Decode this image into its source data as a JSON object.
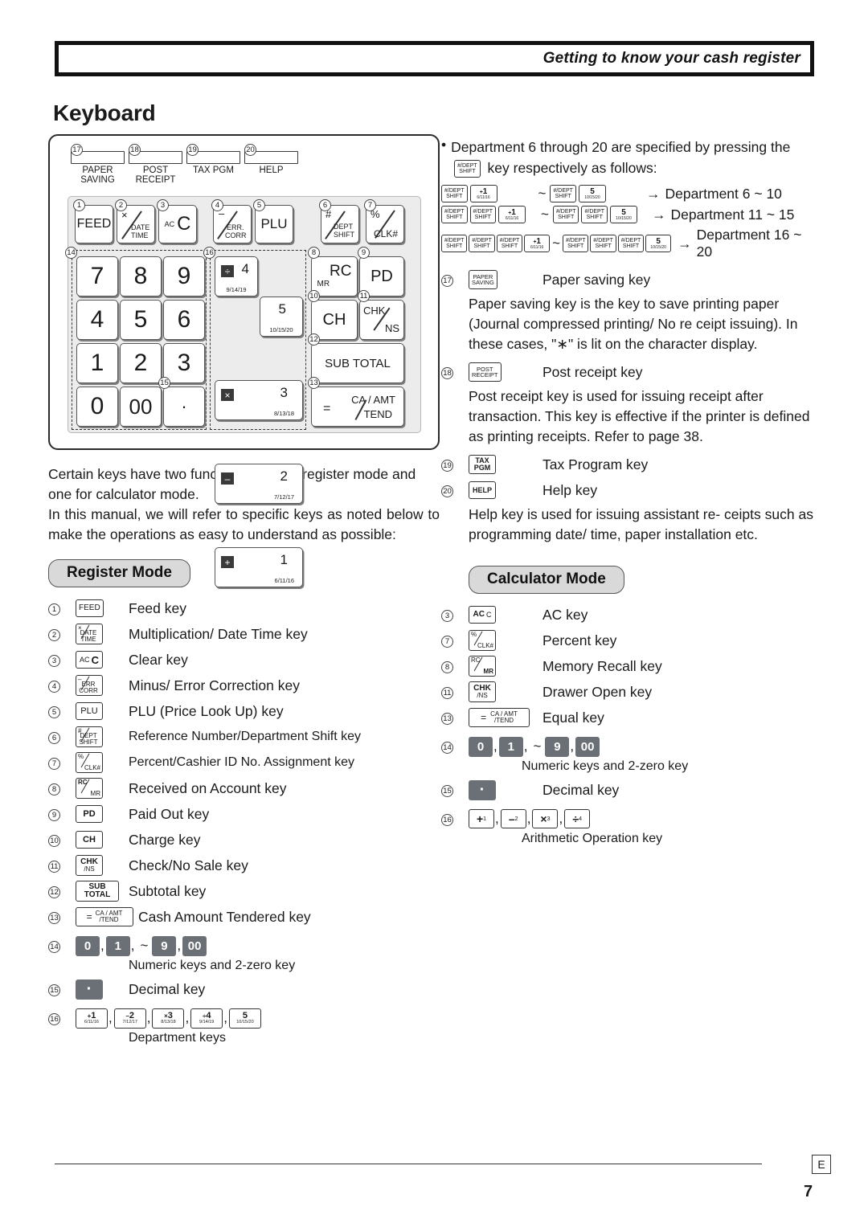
{
  "header": {
    "title": "Getting to know your cash register"
  },
  "page": {
    "title": "Keyboard",
    "number": "7",
    "lang_mark": "E"
  },
  "keyboard_diagram": {
    "top_keys": [
      {
        "num": "17",
        "label_line1": "PAPER",
        "label_line2": "SAVING"
      },
      {
        "num": "18",
        "label_line1": "POST",
        "label_line2": "RECEIPT"
      },
      {
        "num": "19",
        "label_line1": "TAX PGM",
        "label_line2": ""
      },
      {
        "num": "20",
        "label_line1": "HELP",
        "label_line2": ""
      }
    ],
    "function_row": [
      {
        "num": "1",
        "label": "FEED"
      },
      {
        "num": "2",
        "label_top": "×",
        "label_mid": "DATE",
        "label_bot": "TIME"
      },
      {
        "num": "3",
        "label_small": "AC",
        "label_big": "C"
      },
      {
        "num": "4",
        "label_top": "–",
        "label_mid": "ERR.",
        "label_bot": "CORR"
      },
      {
        "num": "5",
        "label": "PLU"
      },
      {
        "num": "6",
        "label_top": "#",
        "label_mid": "DEPT",
        "label_bot": "SHIFT"
      },
      {
        "num": "7",
        "label_top": "%",
        "label_bot": "CLK#"
      }
    ],
    "numeric_group_num": "14",
    "numeric_keys": [
      "7",
      "8",
      "9",
      "4",
      "5",
      "6",
      "1",
      "2",
      "3",
      "0",
      "00"
    ],
    "decimal_group_num": "15",
    "decimal_key": "·",
    "dept_group_num": "16",
    "dept_keys": [
      {
        "op": "÷",
        "num": "4",
        "sub": "9/14/19"
      },
      {
        "op": "",
        "num": "5",
        "sub": "10/15/20"
      },
      {
        "op": "×",
        "num": "3",
        "sub": "8/13/18"
      },
      {
        "op": "–",
        "num": "2",
        "sub": "7/12/17"
      },
      {
        "op": "+",
        "num": "1",
        "sub": "6/11/16"
      }
    ],
    "right_keys": [
      {
        "num": "8",
        "label_small": "MR",
        "label_big": "RC"
      },
      {
        "num": "9",
        "label": "PD"
      },
      {
        "num": "10",
        "label": "CH"
      },
      {
        "num": "11",
        "label_top": "CHK",
        "label_bot": "NS"
      },
      {
        "num": "12",
        "label": "SUB TOTAL"
      },
      {
        "num": "13",
        "label_eq": "=",
        "label_top": "CA / AMT",
        "label_bot": "TEND"
      }
    ]
  },
  "left_column": {
    "intro_p1": "Certain keys have two functions; one for register mode and one for calculator mode.",
    "intro_p2": "In this manual, we will refer to specific keys as noted below to make the operations as easy to understand as possible:",
    "register_mode_badge": "Register Mode",
    "items": [
      {
        "idx": "1",
        "key": {
          "type": "text",
          "text": "FEED"
        },
        "desc": "Feed key"
      },
      {
        "idx": "2",
        "key": {
          "type": "two",
          "l1": "×",
          "l2": "DATE TIME"
        },
        "desc": "Multiplication/ Date Time key"
      },
      {
        "idx": "3",
        "key": {
          "type": "acc",
          "small": "AC",
          "big": "C"
        },
        "desc": "Clear key"
      },
      {
        "idx": "4",
        "key": {
          "type": "two",
          "l1": "–",
          "l2": "ERR CORR"
        },
        "desc": "Minus/ Error Correction key"
      },
      {
        "idx": "5",
        "key": {
          "type": "text",
          "text": "PLU"
        },
        "desc": "PLU (Price Look Up) key"
      },
      {
        "idx": "6",
        "key": {
          "type": "two",
          "l1": "#",
          "l2": "DEPT SHIFT"
        },
        "desc": "Reference Number/Department Shift key"
      },
      {
        "idx": "7",
        "key": {
          "type": "two",
          "l1": "%",
          "l2": "CLK#"
        },
        "desc": "Percent/Cashier ID No. Assignment key"
      },
      {
        "idx": "8",
        "key": {
          "type": "two",
          "l1": "RC",
          "l2": "MR"
        },
        "desc": "Received on Account key"
      },
      {
        "idx": "9",
        "key": {
          "type": "text",
          "text": "PD"
        },
        "desc": "Paid Out key"
      },
      {
        "idx": "10",
        "key": {
          "type": "text",
          "text": "CH"
        },
        "desc": "Charge key"
      },
      {
        "idx": "11",
        "key": {
          "type": "stack",
          "l1": "CHK",
          "l2": "/NS"
        },
        "desc": "Check/No Sale key"
      },
      {
        "idx": "12",
        "key": {
          "type": "stack",
          "l1": "SUB",
          "l2": "TOTAL"
        },
        "desc": "Subtotal key"
      },
      {
        "idx": "13",
        "key": {
          "type": "eq",
          "eq": "=",
          "l1": "CA / AMT",
          "l2": "/TEND"
        },
        "desc": "Cash Amount Tendered key"
      }
    ],
    "numeric_row": {
      "idx": "14",
      "keys": [
        "0",
        "1",
        "9",
        "00"
      ],
      "tilde": "~",
      "comma": ",",
      "desc": "Numeric keys and 2-zero key"
    },
    "decimal_row": {
      "idx": "15",
      "key": "·",
      "desc": "Decimal key"
    },
    "dept_row": {
      "idx": "16",
      "keys": [
        {
          "op": "+",
          "num": "1",
          "sub": "6/11/16"
        },
        {
          "op": "–",
          "num": "2",
          "sub": "7/12/17"
        },
        {
          "op": "×",
          "num": "3",
          "sub": "8/13/18"
        },
        {
          "op": "÷",
          "num": "4",
          "sub": "9/14/19"
        },
        {
          "op": "",
          "num": "5",
          "sub": "10/15/20"
        }
      ],
      "comma": ",",
      "desc": "Department keys"
    }
  },
  "right_column": {
    "bullet_intro": "Department 6 through 20 are specified by pressing the",
    "bullet_intro_tail": "key respectively as follows:",
    "sequences": [
      {
        "shift_count": 1,
        "first_key": {
          "op": "+",
          "num": "1",
          "sub": "6/11/16"
        },
        "tilde": "~",
        "last_key": {
          "op": "",
          "num": "5",
          "sub": "10/15/20"
        },
        "arrow": "→",
        "result": "Department 6 ~ 10"
      },
      {
        "shift_count": 2,
        "first_key": {
          "op": "+",
          "num": "1",
          "sub": "6/11/16"
        },
        "tilde": "~",
        "last_key": {
          "op": "",
          "num": "5",
          "sub": "10/15/20"
        },
        "arrow": "→",
        "result": "Department 11 ~ 15"
      },
      {
        "shift_count": 3,
        "first_key": {
          "op": "+",
          "num": "1",
          "sub": "6/11/16"
        },
        "tilde": "~",
        "last_key": {
          "op": "",
          "num": "5",
          "sub": "10/15/20"
        },
        "arrow": "→",
        "result": "Department 16 ~ 20"
      }
    ],
    "item17": {
      "idx": "17",
      "key_l1": "PAPER",
      "key_l2": "SAVING",
      "desc": "Paper saving key"
    },
    "para17": "Paper saving key is the key to save printing paper (Journal compressed printing/ No re ceipt issuing). In these cases, \"∗\" is lit on the character display.",
    "item18": {
      "idx": "18",
      "key_l1": "POST",
      "key_l2": "RECEIPT",
      "desc": "Post receipt key"
    },
    "para18": "Post receipt key is used for issuing receipt after transaction. This key is effective if the printer is defined as printing receipts. Refer to page 38.",
    "item19": {
      "idx": "19",
      "key_l1": "TAX",
      "key_l2": "PGM",
      "desc": "Tax Program key"
    },
    "item20": {
      "idx": "20",
      "key_l1": "HELP",
      "key_l2": "",
      "desc": "Help key"
    },
    "para20": "Help key is used for issuing assistant re- ceipts such as programming date/ time, paper installation etc.",
    "calculator_mode_badge": "Calculator Mode",
    "calc_items": [
      {
        "idx": "3",
        "key": {
          "type": "acc",
          "small": "AC",
          "big": "C"
        },
        "desc": "AC key"
      },
      {
        "idx": "7",
        "key": {
          "type": "two",
          "l1": "%",
          "l2": "CLK#"
        },
        "desc": "Percent key"
      },
      {
        "idx": "8",
        "key": {
          "type": "two",
          "l1": "RC",
          "l2": "MR"
        },
        "desc": "Memory Recall key"
      },
      {
        "idx": "11",
        "key": {
          "type": "stack",
          "l1": "CHK",
          "l2": "/NS"
        },
        "desc": "Drawer Open key"
      },
      {
        "idx": "13",
        "key": {
          "type": "eq",
          "eq": "=",
          "l1": "CA / AMT",
          "l2": "/TEND"
        },
        "desc": "Equal key"
      }
    ],
    "calc_numeric_row": {
      "idx": "14",
      "keys": [
        "0",
        "1",
        "9",
        "00"
      ],
      "tilde": "~",
      "comma": ",",
      "desc": "Numeric keys and 2-zero key"
    },
    "calc_decimal_row": {
      "idx": "15",
      "key": "·",
      "desc": "Decimal key"
    },
    "calc_arith_row": {
      "idx": "16",
      "keys": [
        {
          "op": "+",
          "sup": "1"
        },
        {
          "op": "–",
          "sup": "2"
        },
        {
          "op": "×",
          "sup": "3"
        },
        {
          "op": "÷",
          "sup": "4"
        }
      ],
      "comma": ",",
      "desc": "Arithmetic Operation key"
    }
  }
}
